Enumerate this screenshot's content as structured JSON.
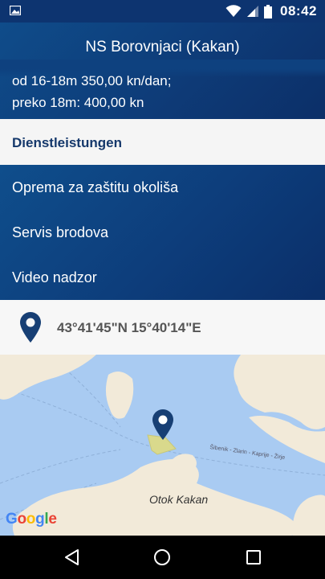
{
  "status_bar": {
    "time": "08:42",
    "icons": [
      "image-icon",
      "wifi-icon",
      "signal-icon",
      "battery-icon"
    ]
  },
  "header": {
    "title": "NS Borovnjaci (Kakan)",
    "price_line_1": "od 16-18m 350,00 kn/dan;",
    "price_line_2": "preko 18m: 400,00 kn"
  },
  "services_section": {
    "heading": "Dienstleistungen",
    "items": [
      {
        "label": "Oprema za zaštitu okoliša"
      },
      {
        "label": "Servis brodova"
      },
      {
        "label": "Video nadzor"
      }
    ]
  },
  "location": {
    "coordinates": "43°41'45\"N 15°40'14\"E",
    "icon": "location-pin-icon"
  },
  "map": {
    "island_label": "Otok Kakan",
    "route_label": "Šibenik - Zlarin - Kaprije - Žirje",
    "attribution": [
      "G",
      "o",
      "o",
      "g",
      "l",
      "e"
    ]
  },
  "nav_bar": {
    "buttons": [
      "back-icon",
      "home-icon",
      "recents-icon"
    ]
  },
  "colors": {
    "primary": "#0e3d7a",
    "section_header_text": "#15386b",
    "map_water": "#a9cbf2",
    "map_land": "#f2ead9",
    "marina_area": "#d9d98c"
  }
}
